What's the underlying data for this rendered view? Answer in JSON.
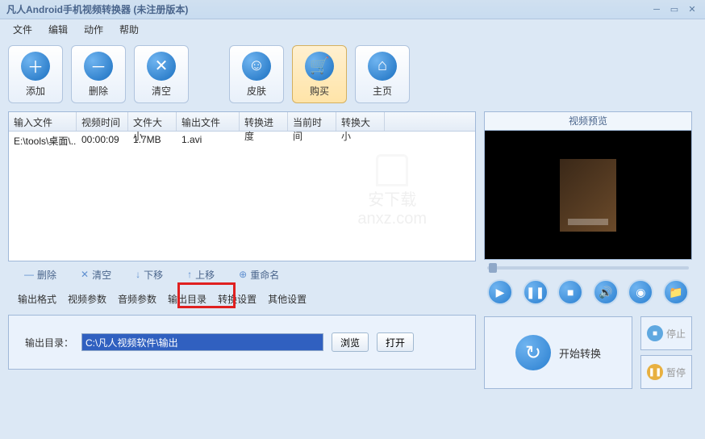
{
  "title": "凡人Android手机视频转换器   (未注册版本)",
  "menu": [
    "文件",
    "编辑",
    "动作",
    "帮助"
  ],
  "toolbar": [
    {
      "icon": "plus",
      "label": "添加"
    },
    {
      "icon": "minus",
      "label": "删除"
    },
    {
      "icon": "x",
      "label": "清空"
    },
    {
      "icon": "smile",
      "label": "皮肤"
    },
    {
      "icon": "cart",
      "label": "购买",
      "highlight": true
    },
    {
      "icon": "home",
      "label": "主页"
    }
  ],
  "table": {
    "headers": [
      "输入文件",
      "视频时间",
      "文件大小",
      "输出文件",
      "转换进度",
      "当前时间",
      "转换大小"
    ],
    "widths": [
      84,
      64,
      60,
      78,
      60,
      60,
      60
    ],
    "rows": [
      [
        "E:\\tools\\桌面\\...",
        "00:00:09",
        "1.7MB",
        "1.avi",
        "",
        "",
        ""
      ]
    ]
  },
  "watermark": {
    "text1": "安下载",
    "text2": "anxz.com"
  },
  "row_actions": [
    {
      "icon": "minus",
      "label": "删除"
    },
    {
      "icon": "x",
      "label": "清空"
    },
    {
      "icon": "down",
      "label": "下移"
    },
    {
      "icon": "up",
      "label": "上移"
    },
    {
      "icon": "rename",
      "label": "重命名"
    }
  ],
  "tabs": [
    "输出格式",
    "视频参数",
    "音频参数",
    "输出目录",
    "转换设置",
    "其他设置"
  ],
  "output": {
    "label": "输出目录：",
    "value": "C:\\凡人视频软件\\输出",
    "browse": "浏览",
    "open": "打开"
  },
  "preview": {
    "title": "视频预览"
  },
  "convert": {
    "start": "开始转换",
    "stop": "停止",
    "pause": "暂停"
  }
}
